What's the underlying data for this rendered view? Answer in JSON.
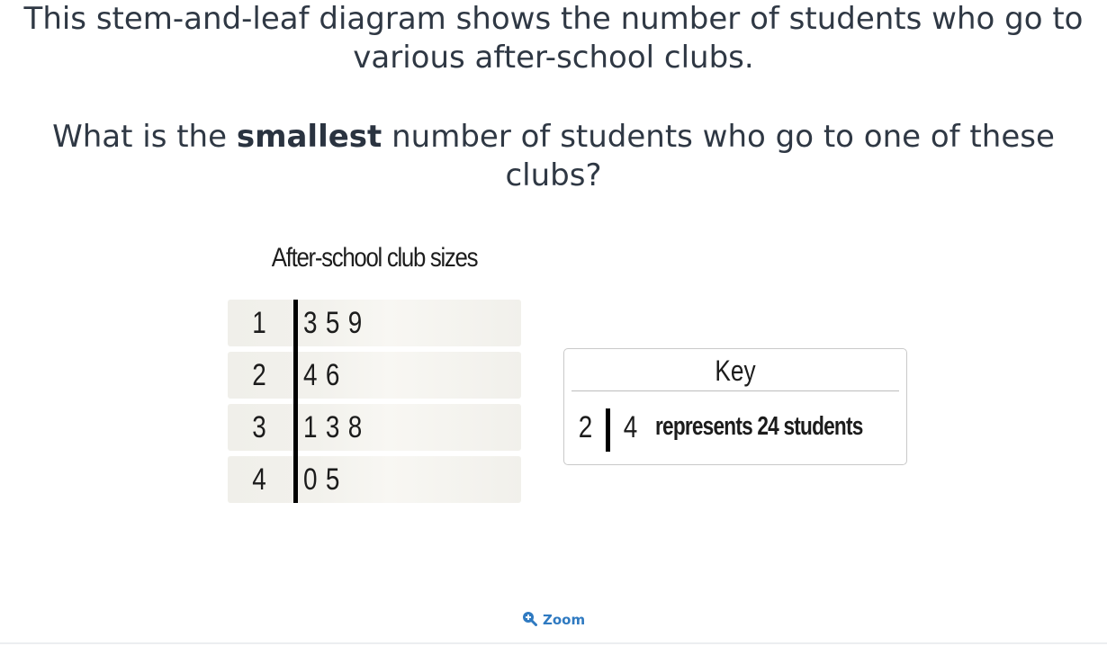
{
  "question": {
    "line1": "This stem-and-leaf diagram shows the number of students who go to various after-school clubs.",
    "prompt_before": "What is the ",
    "prompt_bold": "smallest",
    "prompt_after": " number of students who go to one of these clubs?"
  },
  "plot": {
    "title": "After-school club sizes",
    "rows": [
      {
        "stem": "1",
        "leaves": "3 5 9"
      },
      {
        "stem": "2",
        "leaves": "4 6"
      },
      {
        "stem": "3",
        "leaves": "1 3 8"
      },
      {
        "stem": "4",
        "leaves": "0 5"
      }
    ]
  },
  "key": {
    "title": "Key",
    "stem": "2",
    "leaf": "4",
    "text": "represents 24 students"
  },
  "zoom": {
    "label": "Zoom",
    "icon": "zoom-in-icon",
    "color": "#2f7ac1"
  }
}
